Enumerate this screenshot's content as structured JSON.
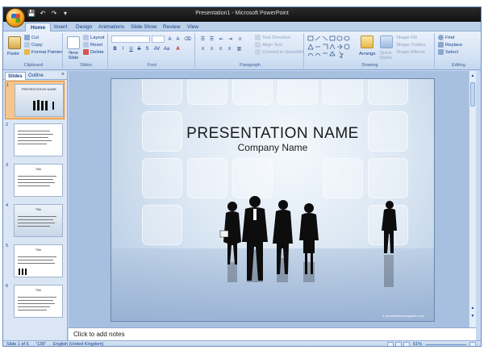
{
  "window": {
    "title": "Presentation1 - Microsoft PowerPoint"
  },
  "qat": {
    "save": "💾",
    "undo": "↶",
    "redo": "↷",
    "more": "▾"
  },
  "tabs": [
    "Home",
    "Insert",
    "Design",
    "Animations",
    "Slide Show",
    "Review",
    "View"
  ],
  "ribbon": {
    "clipboard": {
      "label": "Clipboard",
      "paste": "Paste",
      "cut": "Cut",
      "copy": "Copy",
      "format_painter": "Format Painter"
    },
    "slides": {
      "label": "Slides",
      "new_slide": "New Slide",
      "layout": "Layout",
      "reset": "Reset",
      "delete": "Delete"
    },
    "font": {
      "label": "Font"
    },
    "paragraph": {
      "label": "Paragraph",
      "text_direction": "Text Direction",
      "align_text": "Align Text",
      "smartart": "Convert to SmartArt"
    },
    "drawing": {
      "label": "Drawing",
      "arrange": "Arrange",
      "quick_styles": "Quick Styles",
      "shape_fill": "Shape Fill",
      "shape_outline": "Shape Outline",
      "shape_effects": "Shape Effects"
    },
    "editing": {
      "label": "Editing",
      "find": "Find",
      "replace": "Replace",
      "select": "Select"
    }
  },
  "panel": {
    "tabs": [
      "Slides",
      "Outline"
    ],
    "close": "×",
    "thumbnails": [
      {
        "num": "1",
        "title": "PRESENTATION NAME",
        "selected": true
      },
      {
        "num": "2",
        "title": ""
      },
      {
        "num": "3",
        "title": "Title"
      },
      {
        "num": "4",
        "title": "Title"
      },
      {
        "num": "5",
        "title": "Title"
      },
      {
        "num": "6",
        "title": "Title"
      }
    ]
  },
  "slide": {
    "title": "PRESENTATION  NAME",
    "subtitle": "Company Name",
    "credit": "© presentationmagazine.com"
  },
  "notes": {
    "placeholder": "Click to add notes"
  },
  "status": {
    "slide_info": "Slide 1 of 6",
    "theme": "\"139\"",
    "language": "English (United Kingdom)",
    "zoom": "61%"
  }
}
